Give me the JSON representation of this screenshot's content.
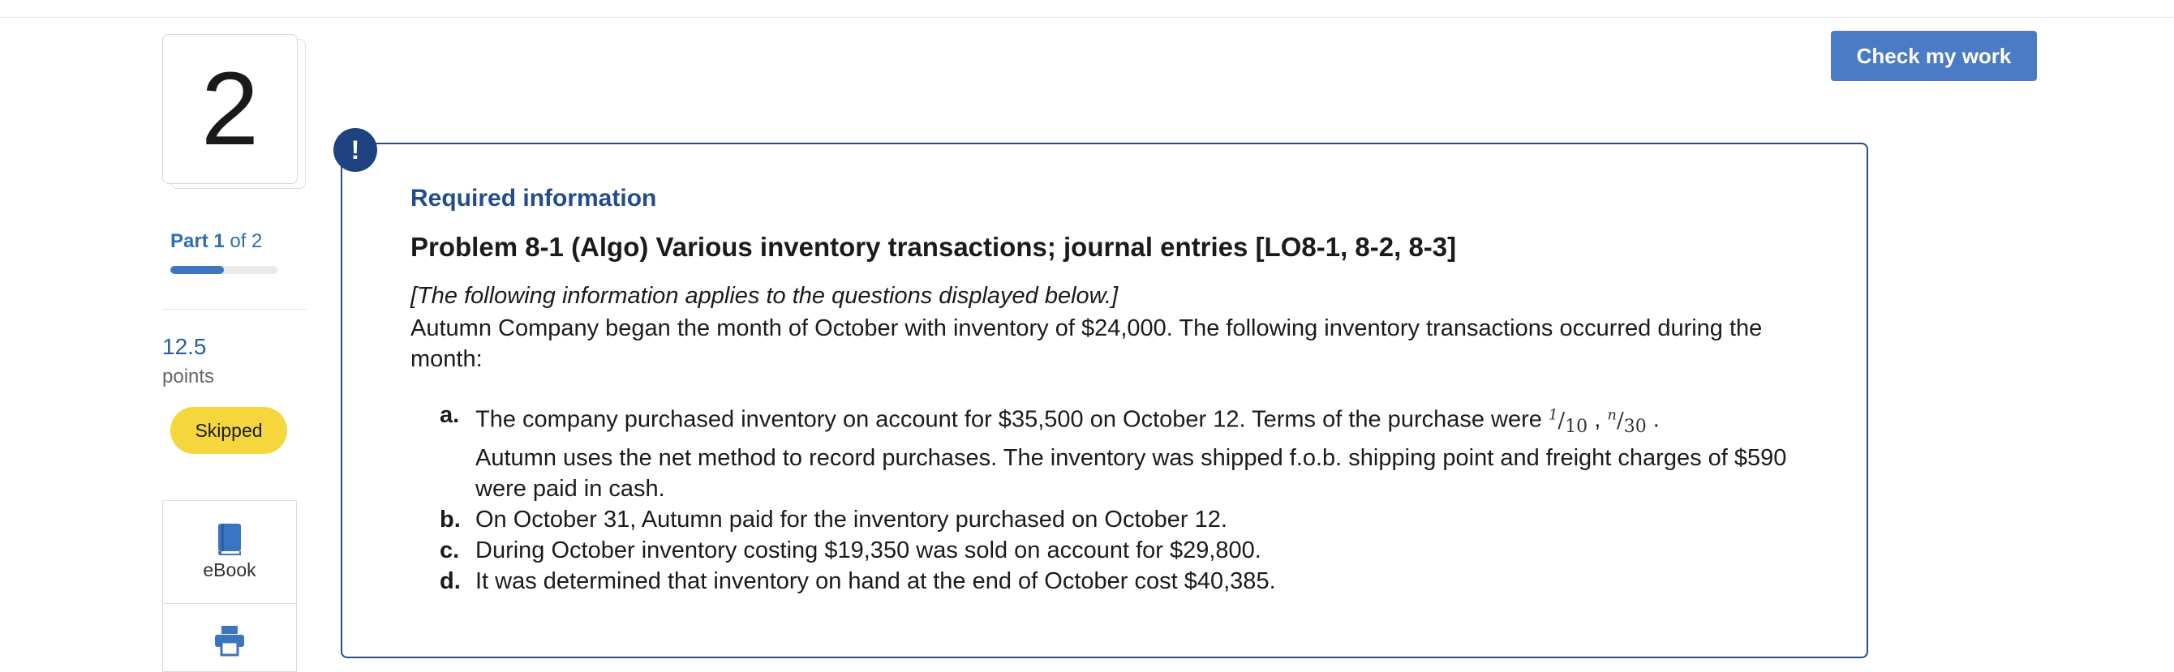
{
  "question": {
    "number": "2"
  },
  "part": {
    "label": "Part 1",
    "of": " of 2",
    "progress": 0.5
  },
  "points": {
    "value": "12.5",
    "label": "points"
  },
  "status_badge": "Skipped",
  "tools": {
    "ebook_label": "eBook",
    "ebook_icon": "book-icon",
    "print_icon": "print-icon"
  },
  "check_button": "Check my work",
  "alert_icon": "!",
  "info": {
    "heading": "Required information",
    "title": "Problem 8-1 (Algo) Various inventory transactions; journal entries [LO8-1, 8-2, 8-3]",
    "note": "[The following information applies to the questions displayed below.]",
    "intro": "Autumn Company began the month of October with inventory of $24,000. The following inventory transactions occurred during the month:",
    "items": [
      {
        "letter": "a.",
        "text_before": "The company purchased inventory on account for $35,500 on October 12. Terms of the purchase were ",
        "terms1_num": "1",
        "terms1_den": "10",
        "sep": " , ",
        "terms2_num": "n",
        "terms2_den": "30",
        "end": " .",
        "text_after": "Autumn uses the net method to record purchases. The inventory was shipped f.o.b. shipping point and freight charges of $590 were paid in cash."
      },
      {
        "letter": "b.",
        "text": "On October 31, Autumn paid for the inventory purchased on October 12."
      },
      {
        "letter": "c.",
        "text": "During October inventory costing $19,350 was sold on account for $29,800."
      },
      {
        "letter": "d.",
        "text": "It was determined that inventory on hand at the end of October cost $40,385."
      }
    ]
  },
  "colors": {
    "accent": "#234c8c",
    "button": "#4a7bc4",
    "badge": "#f5d63d"
  }
}
